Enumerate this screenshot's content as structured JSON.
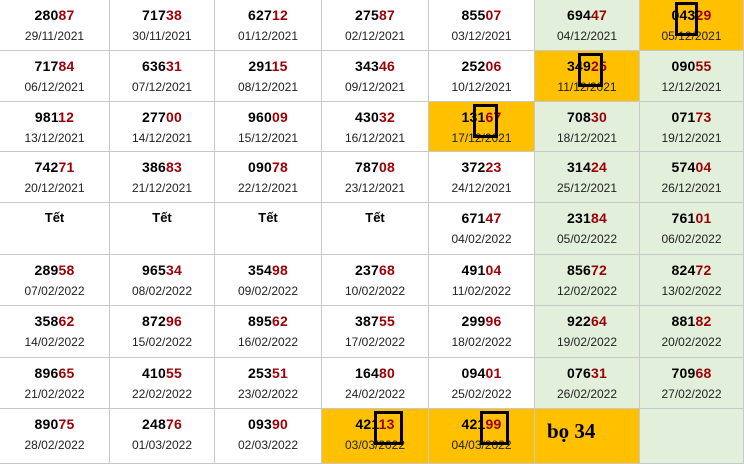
{
  "rows": [
    [
      {
        "num": "28087",
        "date": "29/11/2021"
      },
      {
        "num": "71738",
        "date": "30/11/2021"
      },
      {
        "num": "62712",
        "date": "01/12/2021"
      },
      {
        "num": "27587",
        "date": "02/12/2021"
      },
      {
        "num": "85507",
        "date": "03/12/2021"
      },
      {
        "num": "69447",
        "date": "04/12/2021",
        "bg": "green"
      },
      {
        "num": "04329",
        "date": "05/12/2021",
        "bg": "orange",
        "mark": "left2"
      }
    ],
    [
      {
        "num": "71784",
        "date": "06/12/2021"
      },
      {
        "num": "63631",
        "date": "07/12/2021"
      },
      {
        "num": "29115",
        "date": "08/12/2021"
      },
      {
        "num": "34346",
        "date": "09/12/2021"
      },
      {
        "num": "25206",
        "date": "10/12/2021"
      },
      {
        "num": "34925",
        "date": "11/12/2021",
        "bg": "orange",
        "mark": "mid"
      },
      {
        "num": "09055",
        "date": "12/12/2021",
        "bg": "green"
      }
    ],
    [
      {
        "num": "98112",
        "date": "13/12/2021"
      },
      {
        "num": "27700",
        "date": "14/12/2021"
      },
      {
        "num": "96009",
        "date": "15/12/2021"
      },
      {
        "num": "43032",
        "date": "16/12/2021"
      },
      {
        "num": "13167",
        "date": "17/12/2021",
        "bg": "orange",
        "mark": "mid"
      },
      {
        "num": "70830",
        "date": "18/12/2021",
        "bg": "green"
      },
      {
        "num": "07173",
        "date": "19/12/2021",
        "bg": "green"
      }
    ],
    [
      {
        "num": "74271",
        "date": "20/12/2021"
      },
      {
        "num": "38683",
        "date": "21/12/2021"
      },
      {
        "num": "09078",
        "date": "22/12/2021"
      },
      {
        "num": "78708",
        "date": "23/12/2021"
      },
      {
        "num": "37223",
        "date": "24/12/2021"
      },
      {
        "num": "31424",
        "date": "25/12/2021",
        "bg": "green"
      },
      {
        "num": "57404",
        "date": "26/12/2021",
        "bg": "green"
      }
    ],
    [
      {
        "tet": "Tết"
      },
      {
        "tet": "Tết"
      },
      {
        "tet": "Tết"
      },
      {
        "tet": "Tết"
      },
      {
        "num": "67147",
        "date": "04/02/2022"
      },
      {
        "num": "23184",
        "date": "05/02/2022",
        "bg": "green"
      },
      {
        "num": "76101",
        "date": "06/02/2022",
        "bg": "green"
      }
    ],
    [
      {
        "num": "28958",
        "date": "07/02/2022"
      },
      {
        "num": "96534",
        "date": "08/02/2022"
      },
      {
        "num": "35498",
        "date": "09/02/2022"
      },
      {
        "num": "23768",
        "date": "10/02/2022"
      },
      {
        "num": "49104",
        "date": "11/02/2022"
      },
      {
        "num": "85672",
        "date": "12/02/2022",
        "bg": "green"
      },
      {
        "num": "82472",
        "date": "13/02/2022",
        "bg": "green"
      }
    ],
    [
      {
        "num": "35862",
        "date": "14/02/2022"
      },
      {
        "num": "87296",
        "date": "15/02/2022"
      },
      {
        "num": "89562",
        "date": "16/02/2022"
      },
      {
        "num": "38755",
        "date": "17/02/2022"
      },
      {
        "num": "29996",
        "date": "18/02/2022"
      },
      {
        "num": "92264",
        "date": "19/02/2022",
        "bg": "green"
      },
      {
        "num": "88182",
        "date": "20/02/2022",
        "bg": "green"
      }
    ],
    [
      {
        "num": "89665",
        "date": "21/02/2022"
      },
      {
        "num": "41055",
        "date": "22/02/2022"
      },
      {
        "num": "25351",
        "date": "23/02/2022"
      },
      {
        "num": "16480",
        "date": "24/02/2022"
      },
      {
        "num": "09401",
        "date": "25/02/2022"
      },
      {
        "num": "07631",
        "date": "26/02/2022",
        "bg": "green"
      },
      {
        "num": "70968",
        "date": "27/02/2022",
        "bg": "green"
      }
    ],
    [
      {
        "num": "89075",
        "date": "28/02/2022"
      },
      {
        "num": "24876",
        "date": "01/03/2022"
      },
      {
        "num": "09390",
        "date": "02/03/2022"
      },
      {
        "num": "42113",
        "date": "03/03/2022",
        "bg": "orange",
        "mark": "last2"
      },
      {
        "num": "42199",
        "date": "04/03/2022",
        "bg": "orange",
        "mark": "last2"
      },
      {
        "label": "bọ 34",
        "bg": "orange"
      },
      {
        "bg": "green"
      }
    ]
  ]
}
